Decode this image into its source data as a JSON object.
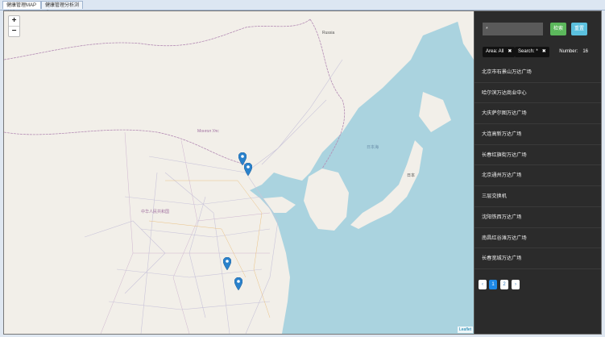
{
  "tabs": [
    {
      "label": "健康管理MAP浏览",
      "active": true
    },
    {
      "label": "健康管理分析浏览",
      "active": false
    }
  ],
  "map": {
    "zoom_in": "+",
    "zoom_out": "−",
    "attribution": "Leaflet",
    "labels": {
      "russia": "Russia",
      "mongolia": "Монгол Улс",
      "china": "中华人民共和国",
      "sea_of_japan": "日本海",
      "japan": "日本"
    },
    "marker_color": "#2a81cb"
  },
  "panel": {
    "search_value": "*",
    "search_button": "检索",
    "reset_button": "重置",
    "filters": [
      {
        "label": "Area: All",
        "remove": "✖"
      },
      {
        "label": "Search: *",
        "remove": "✖"
      }
    ],
    "count_label": "Number:",
    "count_value": "16",
    "items": [
      "北京市石景山万达广场",
      "哈尔滨万达商业中心",
      "大庆萨尔图万达广场",
      "大连高新万达广场",
      "长春红旗街万达广场",
      "北京通州万达广场",
      "三层交换机",
      "沈阳铁西万达广场",
      "南昌红谷滩万达广场",
      "长春宽城万达广场"
    ],
    "pagination": {
      "prev": "‹",
      "pages": [
        "1",
        "2"
      ],
      "active_page": "1",
      "next": "›"
    }
  }
}
